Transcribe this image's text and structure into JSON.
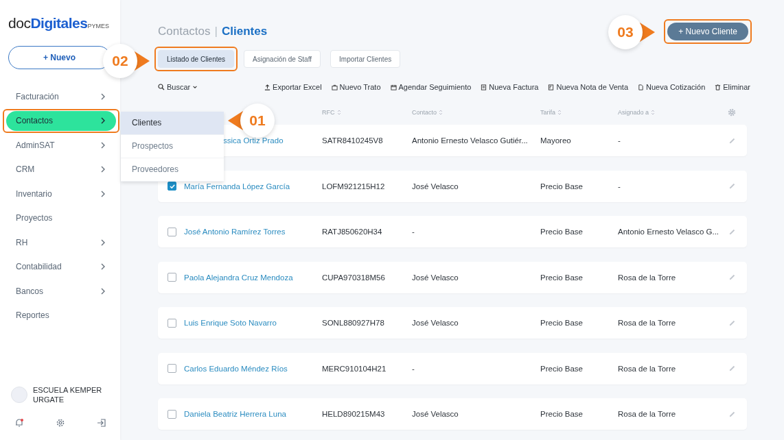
{
  "sidebar": {
    "logo": {
      "prefix": "doc",
      "brand": "Digitales",
      "suffix": "PYMES"
    },
    "new_button": {
      "icon": "+",
      "label": "Nuevo"
    },
    "items": [
      {
        "label": "Facturación",
        "expandable": true,
        "selected": false,
        "highlighted": false
      },
      {
        "label": "Contactos",
        "expandable": true,
        "selected": true,
        "highlighted": true
      },
      {
        "label": "AdminSAT",
        "expandable": true,
        "selected": false,
        "highlighted": false
      },
      {
        "label": "CRM",
        "expandable": true,
        "selected": false,
        "highlighted": false
      },
      {
        "label": "Inventario",
        "expandable": true,
        "selected": false,
        "highlighted": false
      },
      {
        "label": "Proyectos",
        "expandable": false,
        "selected": false,
        "highlighted": false
      },
      {
        "label": "RH",
        "expandable": true,
        "selected": false,
        "highlighted": false
      },
      {
        "label": "Contabilidad",
        "expandable": true,
        "selected": false,
        "highlighted": false
      },
      {
        "label": "Bancos",
        "expandable": true,
        "selected": false,
        "highlighted": false
      },
      {
        "label": "Reportes",
        "expandable": false,
        "selected": false,
        "highlighted": false
      }
    ],
    "account": {
      "name": "ESCUELA KEMPER URGATE"
    },
    "notifications": {
      "unread": true
    }
  },
  "submenu": {
    "items": [
      {
        "label": "Clientes",
        "selected": true
      },
      {
        "label": "Prospectos",
        "selected": false
      },
      {
        "label": "Proveedores",
        "selected": false
      }
    ]
  },
  "breadcrumb": {
    "parent": "Contactos",
    "separator": "|",
    "current": "Clientes"
  },
  "primary_button": {
    "icon": "+",
    "label": "Nuevo Cliente",
    "highlighted": true
  },
  "tabs": [
    {
      "label": "Listado de Clientes",
      "selected": true,
      "highlighted": true
    },
    {
      "label": "Asignación de Staff",
      "selected": false,
      "highlighted": false
    },
    {
      "label": "Importar Clientes",
      "selected": false,
      "highlighted": false
    }
  ],
  "search": {
    "label": "Buscar"
  },
  "actions": [
    {
      "label": "Exportar Excel",
      "kind": "upload"
    },
    {
      "label": "Nuevo Trato",
      "kind": "briefcase"
    },
    {
      "label": "Agendar Seguimiento",
      "kind": "calendar"
    },
    {
      "label": "Nueva Factura",
      "kind": "receipt"
    },
    {
      "label": "Nueva Nota de Venta",
      "kind": "note"
    },
    {
      "label": "Nueva Cotización",
      "kind": "file"
    },
    {
      "label": "Eliminar",
      "kind": "trash"
    }
  ],
  "table": {
    "columns": [
      "RFC",
      "Contacto",
      "Tarifa",
      "Asignado a"
    ],
    "rows": [
      {
        "name": "ssica Ortiz Prado",
        "rfc": "SATR8410245V8",
        "contact": "Antonio Ernesto Velasco Gutiér...",
        "rate": "Mayoreo",
        "assigned": "-"
      },
      {
        "name": "María Fernanda López García",
        "checked": true,
        "rfc": "LOFM921215H12",
        "contact": "José Velasco",
        "rate": "Precio Base",
        "assigned": "-"
      },
      {
        "name": "José Antonio Ramírez Torres",
        "checked": false,
        "rfc": "RATJ850620H34",
        "contact": "-",
        "rate": "Precio Base",
        "assigned": "Antonio Ernesto Velasco G..."
      },
      {
        "name": "Paola Alejandra Cruz Mendoza",
        "checked": false,
        "rfc": "CUPA970318M56",
        "contact": "José Velasco",
        "rate": "Precio Base",
        "assigned": "Rosa de la Torre"
      },
      {
        "name": "Luis Enrique Soto Navarro",
        "checked": false,
        "rfc": "SONL880927H78",
        "contact": "José Velasco",
        "rate": "Precio Base",
        "assigned": "Rosa de la Torre"
      },
      {
        "name": "Carlos Eduardo Méndez Ríos",
        "checked": false,
        "rfc": "MERC910104H21",
        "contact": "-",
        "rate": "Precio Base",
        "assigned": "Rosa de la Torre"
      },
      {
        "name": "Daniela Beatriz Herrera Luna",
        "checked": false,
        "rfc": "HELD890215M43",
        "contact": "José Velasco",
        "rate": "Precio Base",
        "assigned": "Rosa de la Torre"
      }
    ]
  },
  "callouts": [
    {
      "label": "01"
    },
    {
      "label": "02"
    },
    {
      "label": "03"
    }
  ]
}
